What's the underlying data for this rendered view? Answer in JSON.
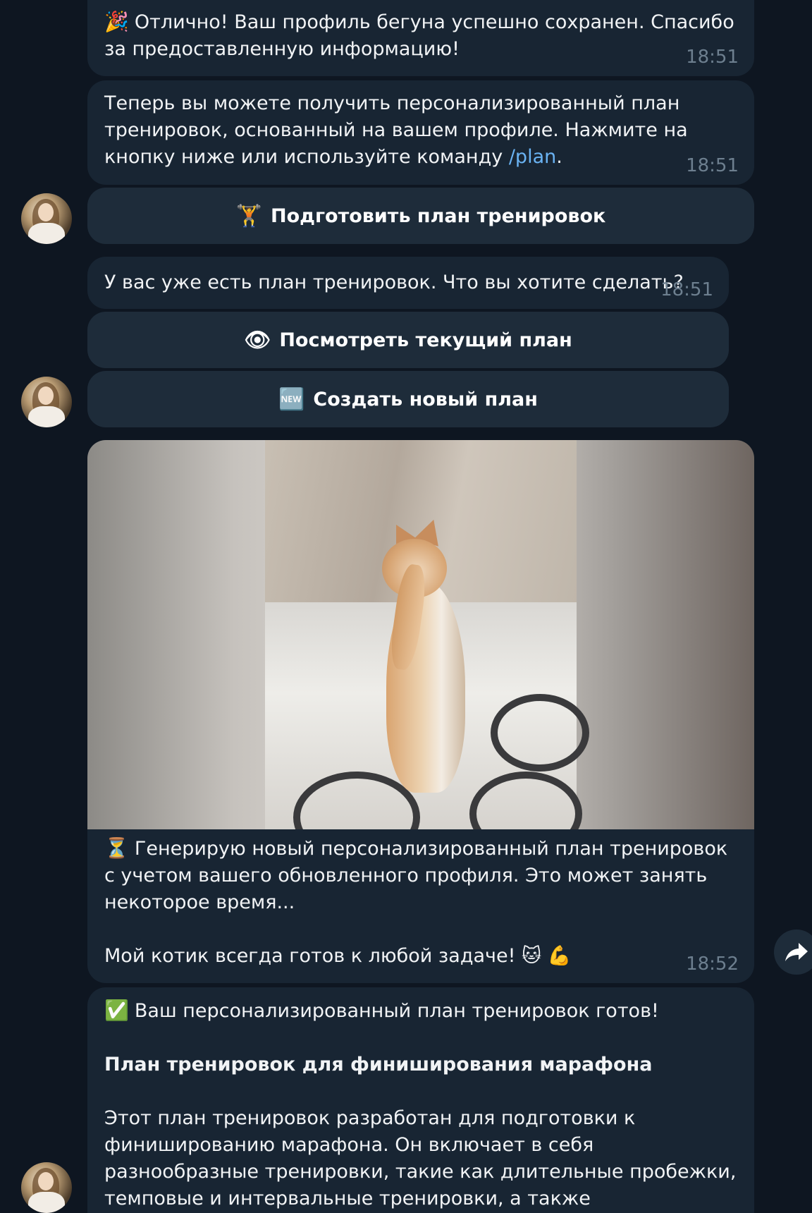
{
  "messages": {
    "m1": {
      "emoji": "🎉",
      "text": "Отлично! Ваш профиль бегуна успешно сохранен. Спасибо за предоставленную информацию!",
      "time": "18:51"
    },
    "m2": {
      "text_before": "Теперь вы можете получить персонализированный план тренировок, основанный на вашем профиле. Нажмите на кнопку ниже или используйте команду ",
      "command": "/plan",
      "text_after": ".",
      "time": "18:51"
    },
    "m3": {
      "text": "У вас уже есть план тренировок. Что вы хотите сделать?",
      "time": "18:51"
    },
    "media_msg": {
      "emoji": "⏳",
      "line1": "Генерирую новый персонализированный план тренировок с учетом вашего обновленного профиля. Это может занять некоторое время...",
      "line2": "Мой котик всегда готов к любой задаче! 🐱 💪",
      "time": "18:52"
    },
    "final": {
      "emoji": "✅",
      "intro": "Ваш персонализированный план тренировок готов!",
      "title": "План тренировок для финиширования марафона",
      "body": "Этот план тренировок разработан для подготовки к финишированию марафона. Он включает в себя разнообразные тренировки, такие как длительные пробежки, темповые и интервальные тренировки, а также восстановительные"
    }
  },
  "buttons": {
    "prepare_plan": {
      "emoji": "🏋",
      "label": "Подготовить план тренировок"
    },
    "view_plan": {
      "emoji": "👁",
      "label": "Посмотреть текущий план"
    },
    "new_plan": {
      "emoji": "🆕",
      "label": "Создать новый план"
    }
  },
  "icons": {
    "forward": "forward-icon",
    "avatar": "user-avatar"
  },
  "colors": {
    "background": "#0e1621",
    "bubble": "#182533",
    "button": "#1e2c3a",
    "link": "#6ab3f3",
    "time": "#6d7f8f"
  }
}
